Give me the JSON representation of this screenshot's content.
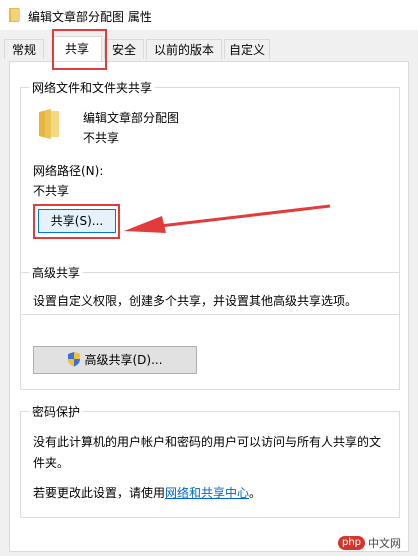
{
  "window": {
    "title": "编辑文章部分配图 属性"
  },
  "tabs": [
    {
      "label": "常规"
    },
    {
      "label": "共享"
    },
    {
      "label": "安全"
    },
    {
      "label": "以前的版本"
    },
    {
      "label": "自定义"
    }
  ],
  "network_share": {
    "group_title": "网络文件和文件夹共享",
    "folder_name": "编辑文章部分配图",
    "folder_status": "不共享",
    "path_label": "网络路径(N):",
    "path_value": "不共享",
    "share_button": "共享(S)..."
  },
  "advanced_share": {
    "group_title": "高级共享",
    "description": "设置自定义权限，创建多个共享，并设置其他高级共享选项。",
    "button": "高级共享(D)..."
  },
  "password_protect": {
    "group_title": "密码保护",
    "line1": "没有此计算机的用户帐户和密码的用户可以访问与所有人共享的文",
    "line2": "件夹。",
    "change_prefix": "若要更改此设置，请使用",
    "change_link": "网络和共享中心",
    "change_suffix": "。"
  },
  "watermark": {
    "badge": "php",
    "text": "中文网"
  },
  "colors": {
    "annotation": "#e23b3b",
    "link": "#0066cc"
  }
}
